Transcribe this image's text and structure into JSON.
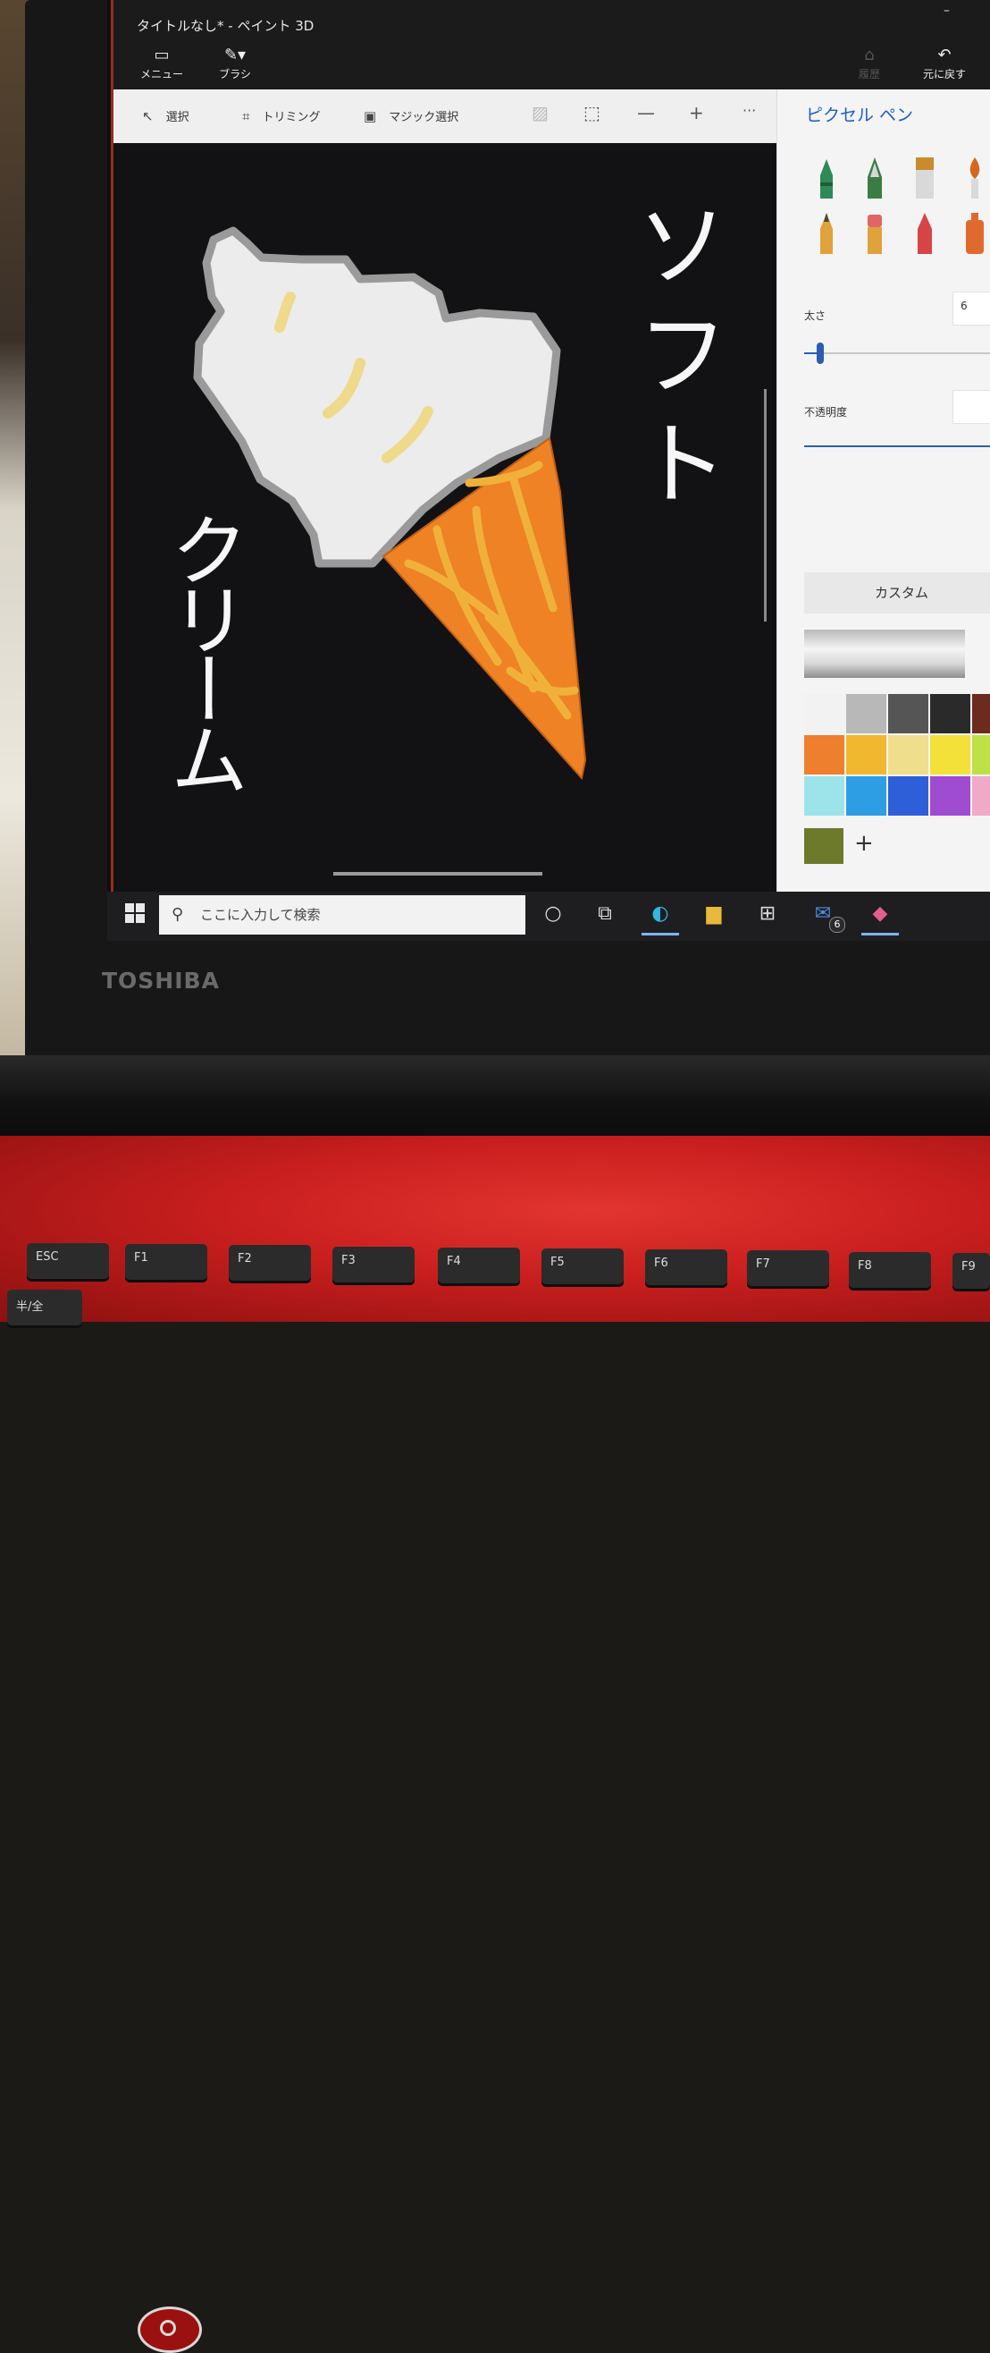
{
  "window": {
    "title": "タイトルなし* - ペイント 3D",
    "minimize_glyph": "–"
  },
  "top_buttons": {
    "menu": "メニュー",
    "brushes": "ブラシ",
    "undo": "元に戻す",
    "history_partial": "履歴"
  },
  "toolbar": {
    "select": "選択",
    "crop": "トリミング",
    "magic_select": "マジック選択",
    "zoom_out": "—",
    "zoom_in": "+",
    "more": "···"
  },
  "canvas": {
    "text_vertical_right": "ソフト",
    "text_vertical_left": "クリーム"
  },
  "panel": {
    "title": "ピクセル ペン",
    "brushes": [
      {
        "icon": "marker-icon",
        "color": "#2e8b57"
      },
      {
        "icon": "calligraphy-pen-icon",
        "color": "#3a7d44"
      },
      {
        "icon": "oil-brush-icon",
        "color": "#c98b2e"
      },
      {
        "icon": "watercolor-icon",
        "color": "#d2691e"
      },
      {
        "icon": "pencil-icon",
        "color": "#e0a23b"
      },
      {
        "icon": "eraser-icon",
        "color": "#e26464"
      },
      {
        "icon": "crayon-icon",
        "color": "#d64545"
      },
      {
        "icon": "spray-can-icon",
        "color": "#e06a2e"
      }
    ],
    "thickness_label": "太さ",
    "thickness_value": "6",
    "opacity_label": "不透明度",
    "custom_label": "カスタム",
    "palette": [
      "#f2f2f2",
      "#b8b8b8",
      "#555555",
      "#2a2a2a",
      "#6d2a1e",
      "#ee7f2e",
      "#f1b72f",
      "#efde8c",
      "#f3e13a",
      "#bfe046",
      "#9de4ea",
      "#2e9ee4",
      "#2f5fd8",
      "#a04cd0",
      "#f0a9c6"
    ],
    "recent_color": "#6d7a2c",
    "add_color": "+"
  },
  "taskbar": {
    "search_placeholder": "ここに入力して検索",
    "mail_badge": "6"
  },
  "laptop": {
    "brand": "TOSHIBA",
    "keys": [
      {
        "label": "ESC"
      },
      {
        "label": "F1"
      },
      {
        "label": "F2"
      },
      {
        "label": "F3"
      },
      {
        "label": "F4"
      },
      {
        "label": "F5"
      },
      {
        "label": "F6"
      },
      {
        "label": "F7"
      },
      {
        "label": "F8"
      },
      {
        "label": "F9"
      }
    ],
    "key_row2_first": "半/全"
  }
}
